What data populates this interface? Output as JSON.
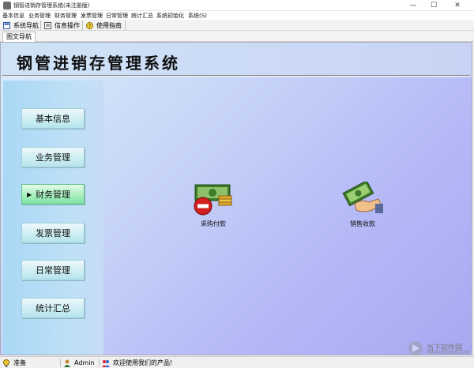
{
  "window": {
    "title": "钢管进销存管理系统(未注册版)",
    "minimize": "—",
    "maximize": "☐",
    "close": "✕"
  },
  "menubar": {
    "items": [
      "基本信息",
      "业务管理",
      "财务管理",
      "发票管理",
      "日常管理",
      "统计汇总",
      "系统初始化",
      "系统(S)"
    ]
  },
  "toolbar": {
    "buttons": [
      {
        "label": "系统导航",
        "icon": "navigation-icon"
      },
      {
        "label": "信息操作",
        "icon": "info-icon"
      },
      {
        "label": "使用指南",
        "icon": "help-icon"
      }
    ]
  },
  "tabs": {
    "active": "图文导航"
  },
  "main": {
    "app_title": "钢管进销存管理系统",
    "nav_items": [
      {
        "label": "基本信息",
        "active": false
      },
      {
        "label": "业务管理",
        "active": false
      },
      {
        "label": "财务管理",
        "active": true
      },
      {
        "label": "发票管理",
        "active": false
      },
      {
        "label": "日常管理",
        "active": false
      },
      {
        "label": "统计汇总",
        "active": false
      }
    ],
    "active_marker": "▶",
    "functions": [
      {
        "label": "采购付款",
        "icon": "purchase-payment-icon"
      },
      {
        "label": "销售收款",
        "icon": "sales-receipt-icon"
      }
    ]
  },
  "statusbar": {
    "status": "准备",
    "user": "Admin",
    "message": "欢迎使用我们的产品!"
  },
  "watermark": {
    "text": "当下软件园",
    "url": "WWW.DOWNXIA.COM"
  },
  "colors": {
    "content_gradient_start": "#d9eefa",
    "content_gradient_end": "#a8a8f2",
    "nav_active": "#a8f0bf",
    "nav_normal": "#cdeef3"
  }
}
